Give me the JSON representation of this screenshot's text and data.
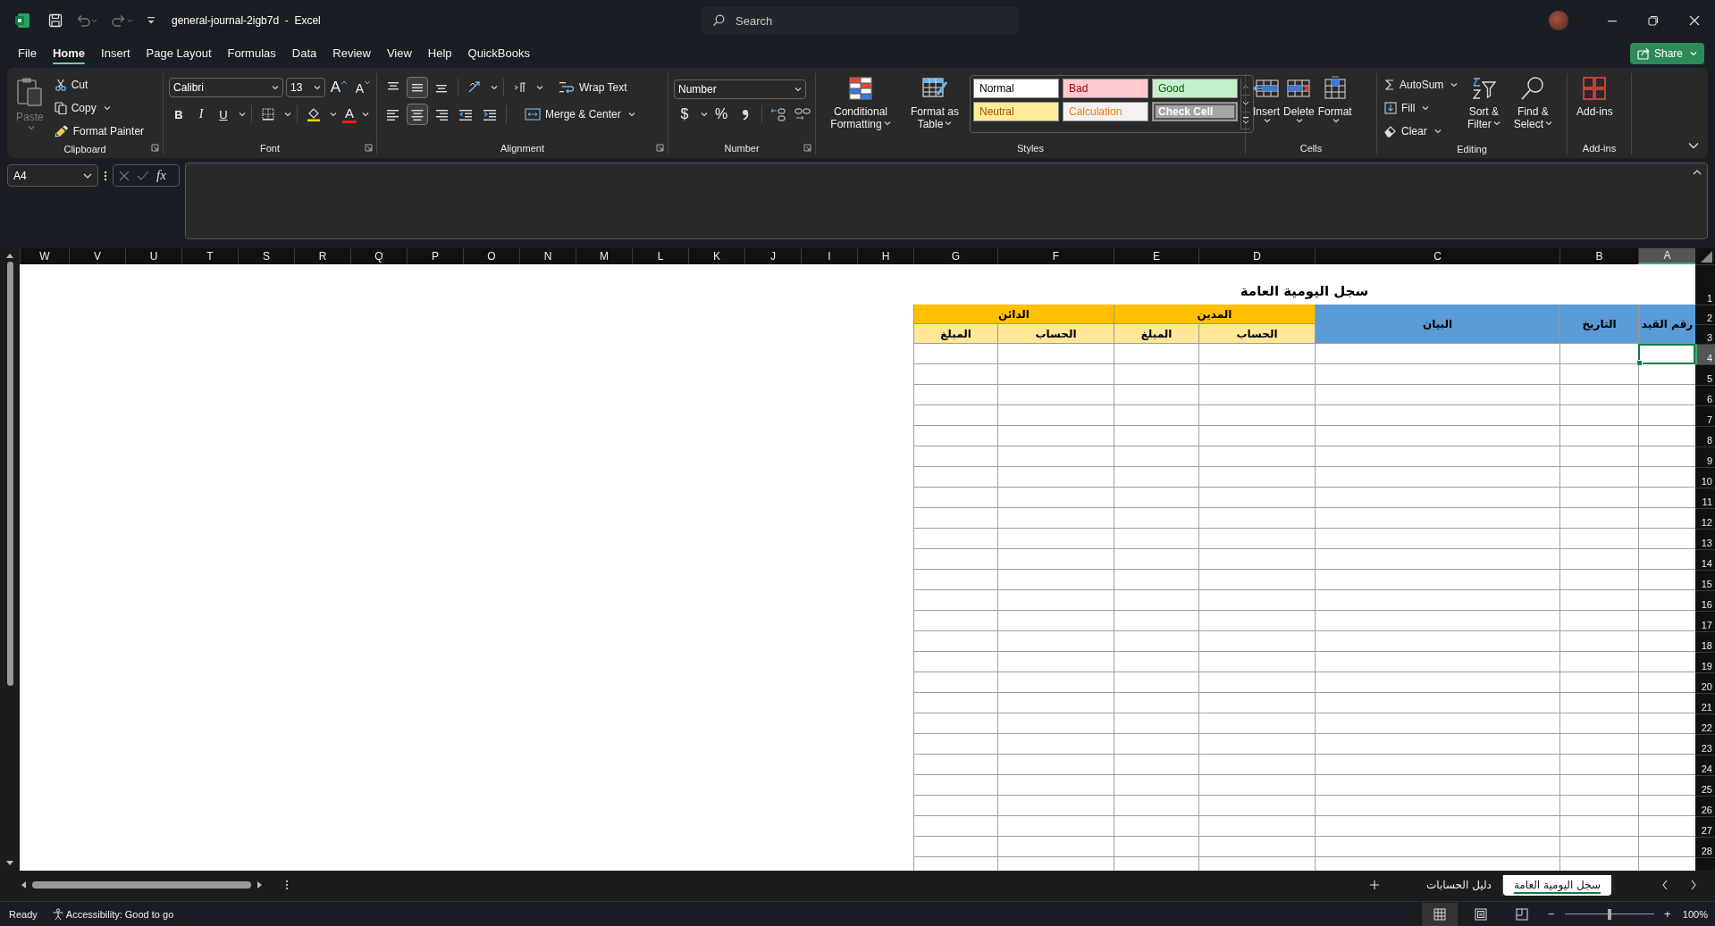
{
  "title_bar": {
    "title": "general-journal-2igb7d  -  Excel",
    "search": {
      "placeholder": "Search"
    }
  },
  "menu_tabs": [
    {
      "label": "File",
      "selected": false
    },
    {
      "label": "Home",
      "selected": true
    },
    {
      "label": "Insert",
      "selected": false
    },
    {
      "label": "Page Layout",
      "selected": false
    },
    {
      "label": "Formulas",
      "selected": false
    },
    {
      "label": "Data",
      "selected": false
    },
    {
      "label": "Review",
      "selected": false
    },
    {
      "label": "View",
      "selected": false
    },
    {
      "label": "Help",
      "selected": false
    },
    {
      "label": "QuickBooks",
      "selected": false
    }
  ],
  "share_button": "Share",
  "clipboard": {
    "paste": {
      "label": "Paste",
      "disabled": true
    },
    "cut": "Cut",
    "copy": "Copy",
    "format_painter": "Format Painter",
    "group_label": "Clipboard"
  },
  "font": {
    "name": "Calibri",
    "size": "13",
    "grow": "A",
    "shrink": "A",
    "bold": "B",
    "italic": "I",
    "underline": "U",
    "font_color": "A",
    "group_label": "Font"
  },
  "alignment": {
    "vertical": [
      {
        "selected": false
      },
      {
        "selected": true
      },
      {
        "selected": false
      }
    ],
    "horizontal": [
      {
        "selected": false
      },
      {
        "selected": true
      },
      {
        "selected": false
      }
    ],
    "wrap_text": "Wrap Text",
    "merge_center": "Merge & Center",
    "group_label": "Alignment"
  },
  "number": {
    "format": "Number",
    "currency": "$",
    "percent": "%",
    "group_label": "Number"
  },
  "styles": {
    "conditional_formatting": "Conditional Formatting",
    "format_as_table": "Format as Table",
    "cell_styles": [
      {
        "label": "Normal",
        "color": "#ffffff"
      },
      {
        "label": "Bad",
        "color": "#ffc7ce"
      },
      {
        "label": "Good",
        "color": "#c6efce"
      },
      {
        "label": "Neutral",
        "color": "#ffeb9c"
      },
      {
        "label": "Calculation",
        "color": "#f2f2f2"
      },
      {
        "label": "Check Cell",
        "color": "#a5a5a5"
      }
    ],
    "group_label": "Styles"
  },
  "cells": {
    "insert": "Insert",
    "delete": "Delete",
    "format": "Format",
    "group_label": "Cells"
  },
  "editing": {
    "autosum": "AutoSum",
    "fill": "Fill",
    "clear": "Clear",
    "sort_filter": "Sort & Filter",
    "find_select": "Find & Select",
    "group_label": "Editing"
  },
  "addins": {
    "button": "Add-ins",
    "group_label": "Add-ins"
  },
  "formula_bar": {
    "name_box": "A4",
    "fx": "fx"
  },
  "sheet": {
    "columns": [
      {
        "label": "W",
        "selected": false
      },
      {
        "label": "V",
        "selected": false
      },
      {
        "label": "U",
        "selected": false
      },
      {
        "label": "T",
        "selected": false
      },
      {
        "label": "S",
        "selected": false
      },
      {
        "label": "R",
        "selected": false
      },
      {
        "label": "Q",
        "selected": false
      },
      {
        "label": "P",
        "selected": false
      },
      {
        "label": "O",
        "selected": false
      },
      {
        "label": "N",
        "selected": false
      },
      {
        "label": "M",
        "selected": false
      },
      {
        "label": "L",
        "selected": false
      },
      {
        "label": "K",
        "selected": false
      },
      {
        "label": "J",
        "selected": false
      },
      {
        "label": "I",
        "selected": false
      },
      {
        "label": "H",
        "selected": false
      },
      {
        "label": "G",
        "selected": false
      },
      {
        "label": "F",
        "selected": false
      },
      {
        "label": "E",
        "selected": false
      },
      {
        "label": "D",
        "selected": false
      },
      {
        "label": "C",
        "selected": false
      },
      {
        "label": "B",
        "selected": false
      },
      {
        "label": "A",
        "selected": true
      }
    ],
    "rows": [
      {
        "label": "1",
        "selected": false
      },
      {
        "label": "2",
        "selected": false
      },
      {
        "label": "3",
        "selected": false
      },
      {
        "label": "4",
        "selected": true
      },
      {
        "label": "5",
        "selected": false
      },
      {
        "label": "6",
        "selected": false
      },
      {
        "label": "7",
        "selected": false
      },
      {
        "label": "8",
        "selected": false
      },
      {
        "label": "9",
        "selected": false
      },
      {
        "label": "10",
        "selected": false
      },
      {
        "label": "11",
        "selected": false
      },
      {
        "label": "12",
        "selected": false
      },
      {
        "label": "13",
        "selected": false
      },
      {
        "label": "14",
        "selected": false
      },
      {
        "label": "15",
        "selected": false
      },
      {
        "label": "16",
        "selected": false
      },
      {
        "label": "17",
        "selected": false
      },
      {
        "label": "18",
        "selected": false
      },
      {
        "label": "19",
        "selected": false
      },
      {
        "label": "20",
        "selected": false
      },
      {
        "label": "21",
        "selected": false
      },
      {
        "label": "22",
        "selected": false
      },
      {
        "label": "23",
        "selected": false
      },
      {
        "label": "24",
        "selected": false
      },
      {
        "label": "25",
        "selected": false
      },
      {
        "label": "26",
        "selected": false
      },
      {
        "label": "27",
        "selected": false
      },
      {
        "label": "28",
        "selected": false
      }
    ]
  },
  "journal": {
    "title": "سجل اليومية العامة",
    "headers": [
      {
        "label": "رقم القيد",
        "kind": "main"
      },
      {
        "label": "التاريخ",
        "kind": "main"
      },
      {
        "label": "البيان",
        "kind": "main"
      },
      {
        "label": "المدين",
        "kind": "group"
      },
      {
        "label": "الدائن",
        "kind": "group"
      },
      {
        "label": "الحساب",
        "kind": "sub"
      },
      {
        "label": "المبلغ",
        "kind": "sub"
      },
      {
        "label": "الحساب",
        "kind": "sub"
      },
      {
        "label": "المبلغ",
        "kind": "sub"
      }
    ]
  },
  "sheet_tabs": [
    {
      "label": "سجل اليومية العامة",
      "selected": true
    },
    {
      "label": "دليل الحسابات",
      "selected": false
    }
  ],
  "status_bar": {
    "ready": "Ready",
    "accessibility": "Accessibility: Good to go",
    "views": [
      {
        "selected": true
      },
      {
        "selected": false
      },
      {
        "selected": false
      }
    ],
    "zoom_out": "−",
    "zoom_in": "+",
    "zoom": {
      "level": 0.5,
      "reading": "100%"
    }
  }
}
